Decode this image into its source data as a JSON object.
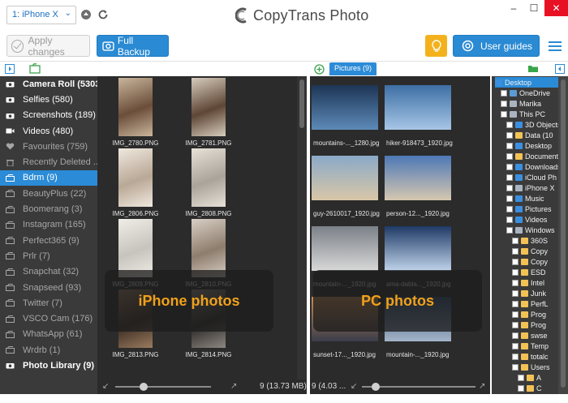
{
  "app": {
    "brand": "CopyTrans Photo",
    "device": "1: iPhone X"
  },
  "toolbar": {
    "apply_label": "Apply changes",
    "backup_label": "Full Backup",
    "guides_label": "User guides"
  },
  "sidebar": {
    "items": [
      {
        "label": "Camera Roll (5303)",
        "icon": "camera-icon",
        "style": "bold"
      },
      {
        "label": "Selfies (580)",
        "icon": "camera-icon",
        "style": "normal"
      },
      {
        "label": "Screenshots (189)",
        "icon": "camera-icon",
        "style": "normal"
      },
      {
        "label": "Videos (480)",
        "icon": "video-icon",
        "style": "normal"
      },
      {
        "label": "Favourites (759)",
        "icon": "heart-icon",
        "style": "dim"
      },
      {
        "label": "Recently Deleted ...",
        "icon": "trash-icon",
        "style": "dim"
      },
      {
        "label": "Bdrm (9)",
        "icon": "album-icon",
        "style": "selected"
      },
      {
        "label": "BeautyPlus (22)",
        "icon": "album-icon",
        "style": "dim"
      },
      {
        "label": "Boomerang (3)",
        "icon": "album-icon",
        "style": "dim"
      },
      {
        "label": "Instagram (165)",
        "icon": "album-icon",
        "style": "dim"
      },
      {
        "label": "Perfect365 (9)",
        "icon": "album-icon",
        "style": "dim"
      },
      {
        "label": "Prlr (7)",
        "icon": "album-icon",
        "style": "dim"
      },
      {
        "label": "Snapchat (32)",
        "icon": "album-icon",
        "style": "dim"
      },
      {
        "label": "Snapseed (93)",
        "icon": "album-icon",
        "style": "dim"
      },
      {
        "label": "Twitter (7)",
        "icon": "album-icon",
        "style": "dim"
      },
      {
        "label": "VSCO Cam (176)",
        "icon": "album-icon",
        "style": "dim"
      },
      {
        "label": "WhatsApp (61)",
        "icon": "album-icon",
        "style": "dim"
      },
      {
        "label": "Wrdrb (1)",
        "icon": "album-icon",
        "style": "dim"
      },
      {
        "label": "Photo Library (9)",
        "icon": "camera-icon",
        "style": "bold"
      }
    ]
  },
  "iphone": {
    "overlay": "iPhone photos",
    "count": "9 (13.73 MB)",
    "photos": [
      "IMG_2780.PNG",
      "IMG_2781.PNG",
      "IMG_2806.PNG",
      "IMG_2808.PNG",
      "IMG_2809.PNG",
      "IMG_2810.PNG",
      "IMG_2813.PNG",
      "IMG_2814.PNG"
    ]
  },
  "pc": {
    "tab": "Pictures (9)",
    "overlay": "PC photos",
    "count": "9 (4.03 ...",
    "photos": [
      "mountains-..._1280.jpg",
      "hiker-918473_1920.jpg",
      "guy-2610017_1920.jpg",
      "person-12..._1920.jpg",
      "mountain-..._1920.jpg",
      "ama-dabla..._1920.jpg",
      "sunset-17..._1920.jpg",
      "mountain-..._1920.jpg"
    ]
  },
  "tree": {
    "items": [
      {
        "label": "Desktop",
        "icon": "blue",
        "level": 0,
        "sel": true
      },
      {
        "label": "OneDrive",
        "icon": "dark",
        "level": 1
      },
      {
        "label": "Marika",
        "icon": "gray",
        "level": 1
      },
      {
        "label": "This PC",
        "icon": "gray",
        "level": 1
      },
      {
        "label": "3D Objects",
        "icon": "blue",
        "level": 2
      },
      {
        "label": "Data (10",
        "icon": "yellow",
        "level": 2
      },
      {
        "label": "Desktop",
        "icon": "blue",
        "level": 2
      },
      {
        "label": "Documents",
        "icon": "yellow",
        "level": 2
      },
      {
        "label": "Downloads",
        "icon": "blue",
        "level": 2
      },
      {
        "label": "iCloud Ph",
        "icon": "blue",
        "level": 2
      },
      {
        "label": "iPhone X",
        "icon": "gray",
        "level": 2
      },
      {
        "label": "Music",
        "icon": "blue",
        "level": 2
      },
      {
        "label": "Pictures",
        "icon": "blue",
        "level": 2
      },
      {
        "label": "Videos",
        "icon": "blue",
        "level": 2
      },
      {
        "label": "Windows",
        "icon": "gray",
        "level": 2
      },
      {
        "label": "360S",
        "icon": "yellow",
        "level": 3
      },
      {
        "label": "Copy",
        "icon": "yellow",
        "level": 3
      },
      {
        "label": "Copy",
        "icon": "yellow",
        "level": 3
      },
      {
        "label": "ESD",
        "icon": "yellow",
        "level": 3
      },
      {
        "label": "Intel",
        "icon": "yellow",
        "level": 3
      },
      {
        "label": "Junk",
        "icon": "yellow",
        "level": 3
      },
      {
        "label": "PerfL",
        "icon": "yellow",
        "level": 3
      },
      {
        "label": "Prog",
        "icon": "yellow",
        "level": 3
      },
      {
        "label": "Prog",
        "icon": "yellow",
        "level": 3
      },
      {
        "label": "swse",
        "icon": "yellow",
        "level": 3
      },
      {
        "label": "Temp",
        "icon": "yellow",
        "level": 3
      },
      {
        "label": "totalc",
        "icon": "yellow",
        "level": 3
      },
      {
        "label": "Users",
        "icon": "yellow",
        "level": 3
      },
      {
        "label": "A",
        "icon": "yellow",
        "level": 4
      },
      {
        "label": "C",
        "icon": "yellow",
        "level": 4
      }
    ]
  },
  "colors": {
    "accent": "#2b8bd6",
    "overlay_text": "#f0a11a",
    "panel": "#2b2b2b"
  }
}
